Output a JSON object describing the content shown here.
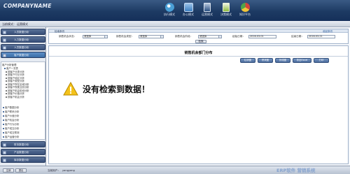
{
  "header": {
    "logo": "COMPANYNAME",
    "modes": [
      {
        "label": "执行模式",
        "color": "#4a9fd6"
      },
      {
        "label": "办公模式",
        "color": "#3c7fc0"
      },
      {
        "label": "运营模式",
        "color": "#294f82"
      },
      {
        "label": "决策模式",
        "color": "#8dbb3e"
      },
      {
        "label": "知识平台",
        "color": "#d2463c"
      }
    ]
  },
  "modebar": {
    "current": "当前模式：",
    "value": "运营模式"
  },
  "sidebar": {
    "top_buttons": [
      "人员数据分析",
      "人力数据分析",
      "人员数据分析",
      "客户数据分析"
    ],
    "tree": {
      "root": "客户分析管理",
      "groups": [
        {
          "label": "客户一览表"
        },
        {
          "label": "按客户分类分析"
        },
        {
          "label": "按客户行业分析"
        },
        {
          "label": "按客户地区分析"
        },
        {
          "label": "按客户类型分析"
        },
        {
          "label": "按客户所在区域分析"
        },
        {
          "label": "按客户所属业务分析"
        },
        {
          "label": "按客户机会阶段分析"
        },
        {
          "label": "按客户价值分析"
        },
        {
          "label": "按客户机会分析"
        }
      ],
      "more": [
        "客户数据分析",
        "客户联系分析",
        "客户价值分析",
        "客户机会分析",
        "客户行为分析",
        "客户成交分析",
        "客户成交预测",
        "客户运营分析"
      ]
    },
    "bottom_buttons": [
      "财务数据分析",
      "产品数据分析",
      "库存数据分析"
    ]
  },
  "filter": {
    "title": "检索条件",
    "right_links": "收起条件",
    "fields": [
      {
        "label": "销售机会状态：",
        "value": "请选择"
      },
      {
        "label": "销售机会类型：",
        "value": "请选择"
      },
      {
        "label": "销售机会阶段：",
        "value": "请选择"
      },
      {
        "label": "起始日期：",
        "value": "2016-03-01"
      },
      {
        "label": "结束日期：",
        "value": "2016-03-21"
      }
    ],
    "query_button": "检索"
  },
  "report": {
    "title": "销售机会部门分布",
    "toolbar": [
      "柱状图",
      "饼状图",
      "折线图",
      "导出Excel",
      "打印"
    ],
    "empty_message": "没有检索到数据！"
  },
  "footer": {
    "buttons": [
      "注销",
      "退出"
    ],
    "user_label": "当前用户：",
    "user_value": "yangyang"
  },
  "watermark": "ERP软件 营销系统",
  "colors": {
    "header": "#1d3a63",
    "accent": "#4a6b9c",
    "warning": "#f4b400"
  }
}
